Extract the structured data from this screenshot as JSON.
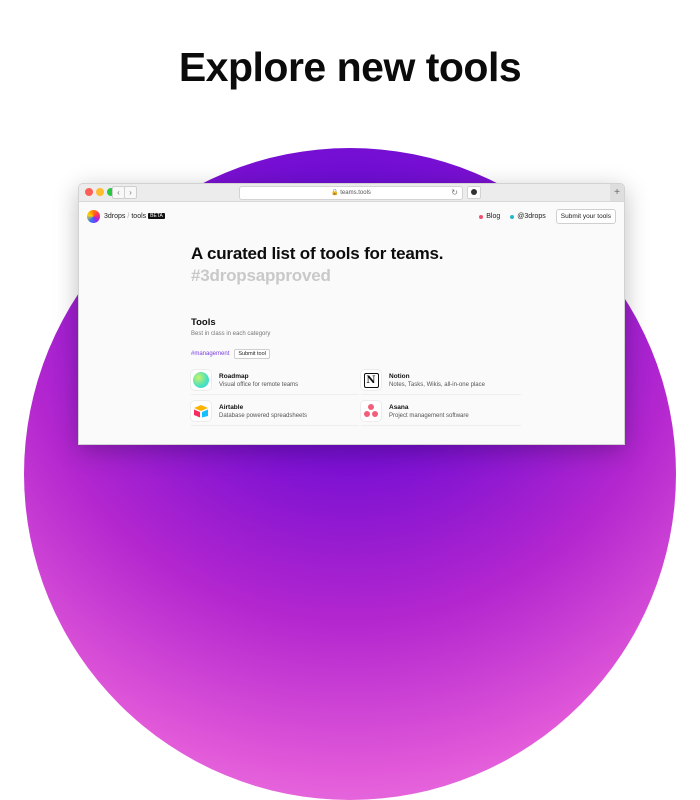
{
  "headline": "Explore new tools",
  "browser": {
    "url": "teams.tools",
    "lock_icon": "lock-icon",
    "back_icon": "chevron-left-icon",
    "forward_icon": "chevron-right-icon",
    "reload_icon": "reload-icon",
    "new_tab_label": "+"
  },
  "site": {
    "brand": "3drops",
    "separator": "/",
    "section": "tools",
    "badge": "BETA",
    "nav": {
      "blog_label": "Blog",
      "handle_label": "@3drops",
      "submit_label": "Submit your tools"
    }
  },
  "hero": {
    "title": "A curated list of tools for teams.",
    "subtitle": "#3dropsapproved"
  },
  "tools_section": {
    "title": "Tools",
    "subtitle": "Best in class in each category",
    "category_tag": "#management",
    "submit_label": "Submit tool",
    "items": [
      {
        "name": "Roadmap",
        "desc": "Visual office for remote teams",
        "icon": "roadmap-icon"
      },
      {
        "name": "Notion",
        "desc": "Notes, Tasks, Wikis, all-in-one place",
        "icon": "notion-icon"
      },
      {
        "name": "Airtable",
        "desc": "Database powered spreadsheets",
        "icon": "airtable-icon"
      },
      {
        "name": "Asana",
        "desc": "Project management software",
        "icon": "asana-icon"
      }
    ]
  },
  "colors": {
    "accent_purple": "#7b3fe4",
    "blog_dot": "#f0506e",
    "handle_dot": "#22b8cf"
  }
}
